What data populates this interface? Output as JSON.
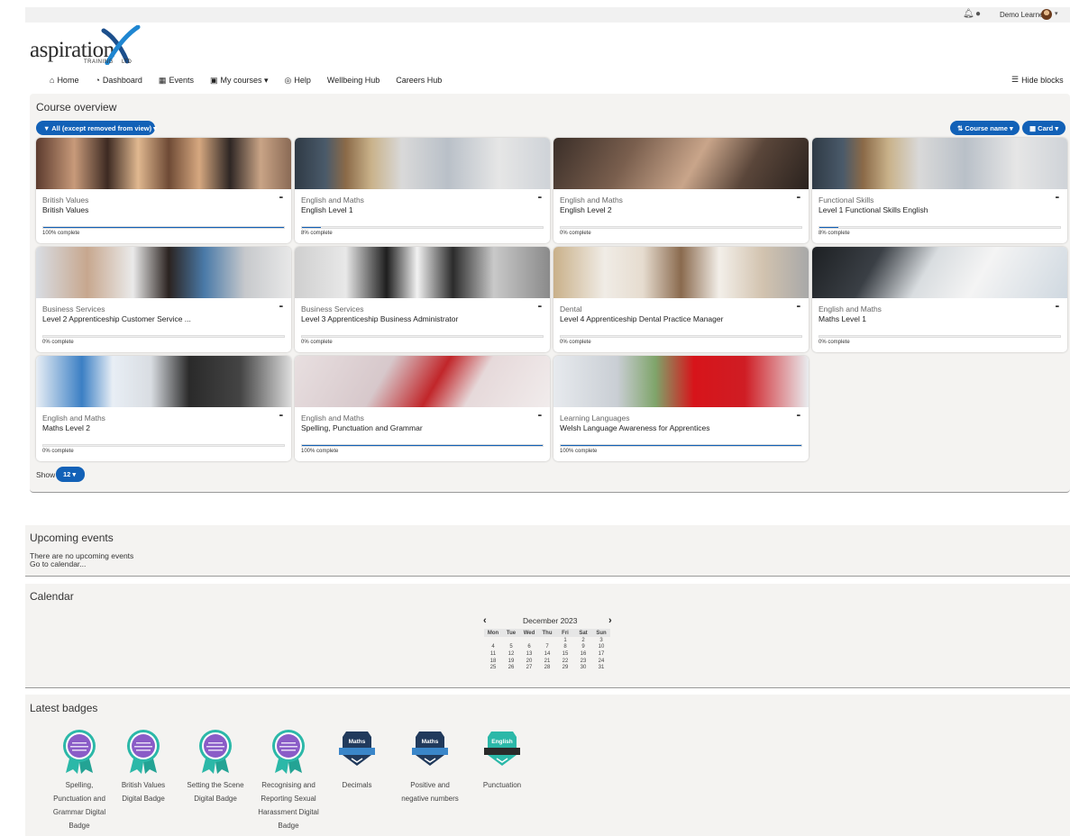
{
  "topbar": {
    "user_name": "Demo Learner"
  },
  "logo": {
    "word": "aspiration",
    "sub": "TRAINING",
    "ltd": "LTD"
  },
  "nav": {
    "items": [
      {
        "icon": "home-icon",
        "glyph": "⌂",
        "label": "Home"
      },
      {
        "icon": "dashboard-icon",
        "glyph": "◔",
        "label": "Dashboard"
      },
      {
        "icon": "calendar-icon",
        "glyph": "▦",
        "label": "Events"
      },
      {
        "icon": "briefcase-icon",
        "glyph": "▣",
        "label": "My courses ▾"
      },
      {
        "icon": "lifebuoy-icon",
        "glyph": "◎",
        "label": "Help"
      },
      {
        "icon": "",
        "glyph": "",
        "label": "Wellbeing Hub"
      },
      {
        "icon": "",
        "glyph": "",
        "label": "Careers Hub"
      }
    ],
    "hide_blocks": "Hide blocks"
  },
  "course_overview": {
    "title": "Course overview",
    "filter_label": "▼ All (except removed from view) ▾",
    "sort_label": "Course name ▾",
    "view_label": "Card ▾",
    "show_label": "Show",
    "show_value": "12 ▾",
    "courses": [
      {
        "category": "British Values",
        "name": "British Values",
        "progress": 100,
        "progress_text": "100% complete",
        "image": "people"
      },
      {
        "category": "English and Maths",
        "name": "English Level 1",
        "progress": 8,
        "progress_text": "8% complete",
        "image": "books"
      },
      {
        "category": "English and Maths",
        "name": "English Level 2",
        "progress": 0,
        "progress_text": "0% complete",
        "image": "pen"
      },
      {
        "category": "Functional Skills",
        "name": "Level 1 Functional Skills English",
        "progress": 8,
        "progress_text": "8% complete",
        "image": "books"
      },
      {
        "category": "Business Services",
        "name": "Level 2 Apprenticeship Customer Service ...",
        "progress": 0,
        "progress_text": "0% complete",
        "image": "office"
      },
      {
        "category": "Business Services",
        "name": "Level 3 Apprenticeship Business Administrator",
        "progress": 0,
        "progress_text": "0% complete",
        "image": "files"
      },
      {
        "category": "Dental",
        "name": "Level 4 Apprenticeship Dental Practice Manager",
        "progress": 0,
        "progress_text": "0% complete",
        "image": "dental"
      },
      {
        "category": "English and Maths",
        "name": "Maths Level 1",
        "progress": 0,
        "progress_text": "0% complete",
        "image": "writing"
      },
      {
        "category": "English and Maths",
        "name": "Maths Level 2",
        "progress": 0,
        "progress_text": "0% complete",
        "image": "calculator"
      },
      {
        "category": "English and Maths",
        "name": "Spelling, Punctuation and Grammar",
        "progress": 100,
        "progress_text": "100% complete",
        "image": "redpen"
      },
      {
        "category": "Learning Languages",
        "name": "Welsh Language Awareness for Apprentices",
        "progress": 100,
        "progress_text": "100% complete",
        "image": "keyboard"
      }
    ]
  },
  "upcoming_events": {
    "title": "Upcoming events",
    "empty_text": "There are no upcoming events",
    "link": "Go to calendar..."
  },
  "calendar": {
    "title": "Calendar",
    "month": "December 2023",
    "weekdays": [
      "Mon",
      "Tue",
      "Wed",
      "Thu",
      "Fri",
      "Sat",
      "Sun"
    ],
    "weeks": [
      [
        "",
        "",
        "",
        "",
        "1",
        "2",
        "3"
      ],
      [
        "4",
        "5",
        "6",
        "7",
        "8",
        "9",
        "10"
      ],
      [
        "11",
        "12",
        "13",
        "14",
        "15",
        "16",
        "17"
      ],
      [
        "18",
        "19",
        "20",
        "21",
        "22",
        "23",
        "24"
      ],
      [
        "25",
        "26",
        "27",
        "28",
        "29",
        "30",
        "31"
      ]
    ]
  },
  "latest_badges": {
    "title": "Latest badges",
    "badges": [
      {
        "label": "Spelling, Punctuation and Grammar Digital Badge",
        "style": "purple"
      },
      {
        "label": "British Values Digital Badge",
        "style": "purple"
      },
      {
        "label": "Setting the Scene Digital Badge",
        "style": "purple"
      },
      {
        "label": "Recognising and Reporting Sexual Harassment Digital Badge",
        "style": "purple"
      },
      {
        "label": "Decimals",
        "style": "maths",
        "tag": "Maths"
      },
      {
        "label": "Positive and negative numbers",
        "style": "maths",
        "tag": "Maths"
      },
      {
        "label": "Punctuation",
        "style": "english",
        "tag": "English"
      }
    ]
  },
  "colors": {
    "accent": "#1261b7",
    "panel": "#f4f3f1",
    "teal": "#2bb8a8",
    "purple": "#8a5cc7",
    "navy": "#213a5c"
  }
}
